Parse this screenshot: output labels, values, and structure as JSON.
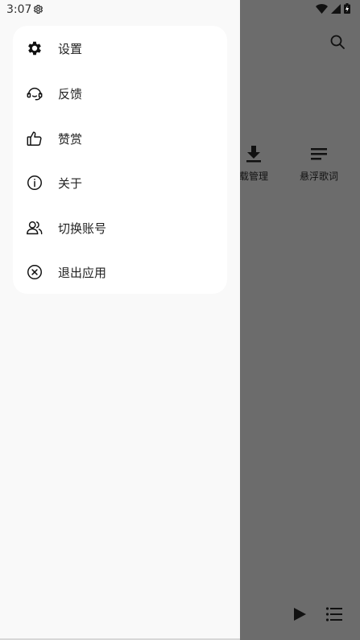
{
  "status_bar": {
    "time": "3:07"
  },
  "menu": {
    "items": [
      {
        "label": "设置",
        "icon": "gear-icon"
      },
      {
        "label": "反馈",
        "icon": "headset-icon"
      },
      {
        "label": "赞赏",
        "icon": "thumbs-up-icon"
      },
      {
        "label": "关于",
        "icon": "info-icon"
      },
      {
        "label": "切换账号",
        "icon": "users-icon"
      },
      {
        "label": "退出应用",
        "icon": "close-circle-icon"
      }
    ]
  },
  "background": {
    "shortcuts": [
      {
        "label": "载管理",
        "icon": "download-icon"
      },
      {
        "label": "悬浮歌词",
        "icon": "lyrics-icon"
      }
    ]
  }
}
